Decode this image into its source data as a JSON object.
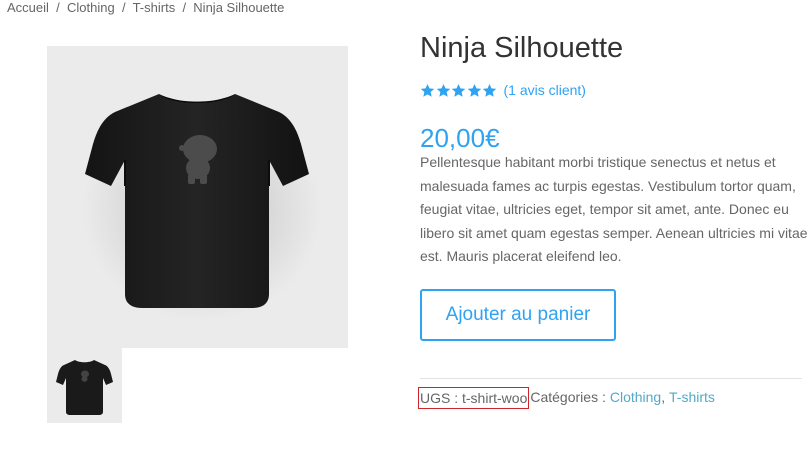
{
  "breadcrumb": {
    "items": [
      "Accueil",
      "Clothing",
      "T-shirts"
    ],
    "current": "Ninja Silhouette",
    "separator": "/"
  },
  "product": {
    "title": "Ninja Silhouette",
    "rating_value": 5,
    "rating_max": 5,
    "review_link": "(1 avis client)",
    "price": "20,00€",
    "description": "Pellentesque habitant morbi tristique senectus et netus et malesuada fames ac turpis egestas. Vestibulum tortor quam, feugiat vitae, ultricies eget, tempor sit amet, ante. Donec eu libero sit amet quam egestas semper. Aenean ultricies mi vitae est. Mauris placerat eleifend leo.",
    "add_to_cart": "Ajouter au panier",
    "sku_text": "UGS : t-shirt-woo",
    "categories_label": "Catégories :",
    "categories": [
      "Clothing",
      "T-shirts"
    ],
    "category_separator": ", "
  },
  "icons": {
    "star": "star-icon",
    "product_image": "tshirt-image",
    "thumbnail": "tshirt-thumbnail"
  },
  "colors": {
    "accent": "#2ea3f2",
    "category_link": "#53a9c6",
    "sku_highlight": "#d0242b",
    "star": "#2ea3f2",
    "image_bg": "#ebebeb",
    "shirt": "#1b1b1b"
  }
}
